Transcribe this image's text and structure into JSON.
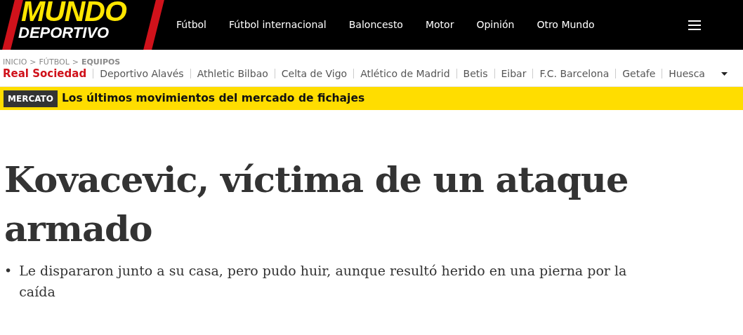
{
  "logo": {
    "line_1": "MUNDO",
    "line_2": "DEPORTIVO"
  },
  "nav": [
    {
      "label": "Fútbol"
    },
    {
      "label": "Fútbol internacional"
    },
    {
      "label": "Baloncesto"
    },
    {
      "label": "Motor"
    },
    {
      "label": "Opinión"
    },
    {
      "label": "Otro Mundo"
    }
  ],
  "breadcrumb": [
    {
      "label": "INICIO",
      "current": false
    },
    {
      "label": "FÚTBOL",
      "current": false
    },
    {
      "label": "EQUIPOS",
      "current": true
    }
  ],
  "breadcrumb_separator": ">",
  "teams": [
    {
      "label": "Real Sociedad",
      "selected": true
    },
    {
      "label": "Deportivo Alavés",
      "selected": false
    },
    {
      "label": "Athletic Bilbao",
      "selected": false
    },
    {
      "label": "Celta de Vigo",
      "selected": false
    },
    {
      "label": "Atlético de Madrid",
      "selected": false
    },
    {
      "label": "Betis",
      "selected": false
    },
    {
      "label": "Eibar",
      "selected": false
    },
    {
      "label": "F.C. Barcelona",
      "selected": false
    },
    {
      "label": "Getafe",
      "selected": false
    },
    {
      "label": "Huesca",
      "selected": false
    }
  ],
  "banner": {
    "tag": "MERCATO",
    "text": "Los últimos movimientos del mercado de fichajes"
  },
  "article": {
    "headline": "Kovacevic, víctima de un ataque armado",
    "bullet": "•",
    "summary": [
      "Le dispararon junto a su casa, pero pudo huir, aunque resultó herido en una pierna por la caída"
    ]
  }
}
